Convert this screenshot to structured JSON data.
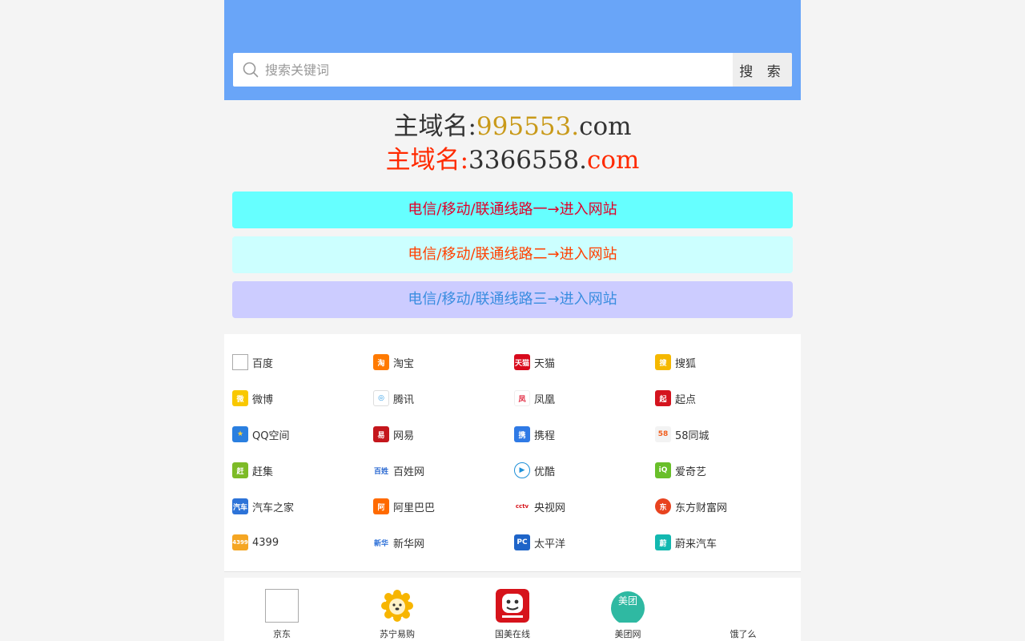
{
  "search": {
    "placeholder": "搜索关键词",
    "button_label": "搜 索"
  },
  "domains": [
    {
      "prefix": "主域名:",
      "highlight": "995553.",
      "suffix": "com"
    },
    {
      "prefix": "主域名:",
      "highlight": "3366558.",
      "suffix": "com"
    }
  ],
  "colors": {
    "header_bg": "#69a5f8",
    "route_1_bg": "#66ffff",
    "route_1_text": "#e0002a",
    "route_2_bg": "#ccffff",
    "route_2_text": "#ff4000",
    "route_3_bg": "#ccccff",
    "route_3_text": "#3a8de0"
  },
  "routes": [
    {
      "label": "电信/移动/联通线路一→进入网站"
    },
    {
      "label": "电信/移动/联通线路二→进入网站"
    },
    {
      "label": "电信/移动/联通线路三→进入网站"
    }
  ],
  "links": [
    {
      "label": "百度",
      "icon": "broken-image-icon"
    },
    {
      "label": "淘宝",
      "icon": "taobao-icon"
    },
    {
      "label": "天猫",
      "icon": "tmall-icon"
    },
    {
      "label": "搜狐",
      "icon": "sohu-icon"
    },
    {
      "label": "微博",
      "icon": "weibo-icon"
    },
    {
      "label": "腾讯",
      "icon": "tencent-icon"
    },
    {
      "label": "凤凰",
      "icon": "ifeng-icon"
    },
    {
      "label": "起点",
      "icon": "qidian-icon"
    },
    {
      "label": "QQ空间",
      "icon": "qzone-icon"
    },
    {
      "label": "网易",
      "icon": "netease-icon"
    },
    {
      "label": "携程",
      "icon": "ctrip-icon"
    },
    {
      "label": "58同城",
      "icon": "58-icon"
    },
    {
      "label": "赶集",
      "icon": "ganji-icon"
    },
    {
      "label": "百姓网",
      "icon": "baixing-icon"
    },
    {
      "label": "优酷",
      "icon": "youku-icon"
    },
    {
      "label": "爱奇艺",
      "icon": "iqiyi-icon"
    },
    {
      "label": "汽车之家",
      "icon": "autohome-icon"
    },
    {
      "label": "阿里巴巴",
      "icon": "alibaba-icon"
    },
    {
      "label": "央视网",
      "icon": "cctv-icon"
    },
    {
      "label": "东方财富网",
      "icon": "eastmoney-icon"
    },
    {
      "label": "4399",
      "icon": "4399-icon"
    },
    {
      "label": "新华网",
      "icon": "xinhua-icon"
    },
    {
      "label": "太平洋",
      "icon": "pconline-icon"
    },
    {
      "label": "蔚来汽车",
      "icon": "nio-icon"
    }
  ],
  "apps": [
    {
      "label": "京东",
      "icon": "broken-image-icon"
    },
    {
      "label": "苏宁易购",
      "icon": "suning-icon"
    },
    {
      "label": "国美在线",
      "icon": "gome-icon"
    },
    {
      "label": "美团网",
      "icon": "meituan-icon"
    },
    {
      "label": "饿了么",
      "icon": "eleme-icon"
    }
  ]
}
